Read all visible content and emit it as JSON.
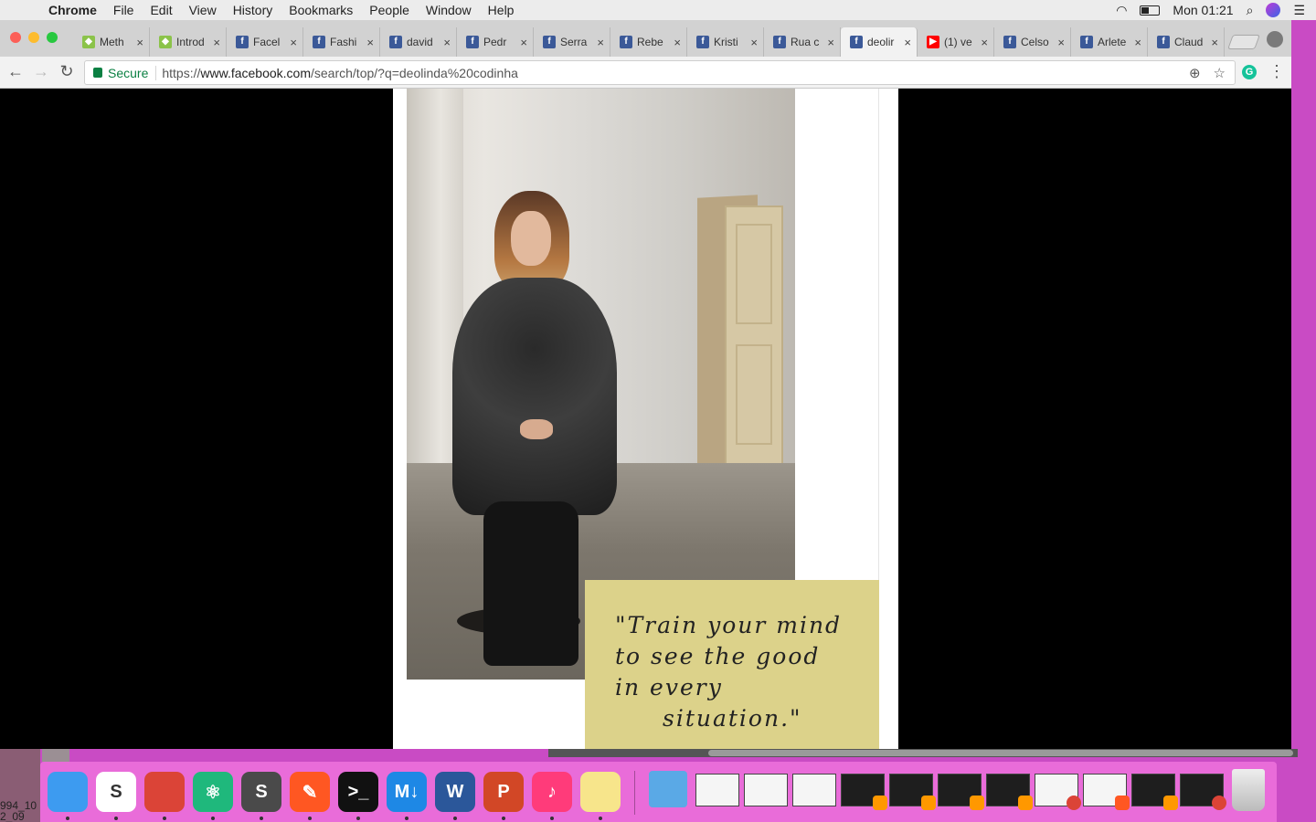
{
  "menubar": {
    "app_name": "Chrome",
    "items": [
      "File",
      "Edit",
      "View",
      "History",
      "Bookmarks",
      "People",
      "Window",
      "Help"
    ],
    "clock": "Mon 01:21"
  },
  "tabs": [
    {
      "label": "Meth",
      "icon": "angular-icon",
      "color": "#8bc34a"
    },
    {
      "label": "Introd",
      "icon": "angular-icon",
      "color": "#8bc34a"
    },
    {
      "label": "Facel",
      "icon": "facebook-icon",
      "color": "#3b5998"
    },
    {
      "label": "Fashi",
      "icon": "facebook-icon",
      "color": "#3b5998"
    },
    {
      "label": "david",
      "icon": "facebook-icon",
      "color": "#3b5998"
    },
    {
      "label": "Pedr",
      "icon": "facebook-icon",
      "color": "#3b5998"
    },
    {
      "label": "Serra",
      "icon": "facebook-icon",
      "color": "#3b5998"
    },
    {
      "label": "Rebe",
      "icon": "facebook-icon",
      "color": "#3b5998"
    },
    {
      "label": "Kristi",
      "icon": "facebook-icon",
      "color": "#3b5998"
    },
    {
      "label": "Rua c",
      "icon": "facebook-icon",
      "color": "#3b5998"
    },
    {
      "label": "deolir",
      "icon": "facebook-icon",
      "color": "#3b5998",
      "active": true
    },
    {
      "label": "(1) ve",
      "icon": "youtube-icon",
      "color": "#ff0000"
    },
    {
      "label": "Celso",
      "icon": "facebook-icon",
      "color": "#3b5998"
    },
    {
      "label": "Arlete",
      "icon": "facebook-icon",
      "color": "#3b5998"
    },
    {
      "label": "Claud",
      "icon": "facebook-icon",
      "color": "#3b5998"
    }
  ],
  "toolbar": {
    "secure_label": "Secure",
    "url_scheme": "https://",
    "url_host": "www.facebook.com",
    "url_path": "/search/top/?q=deolinda%20codinha"
  },
  "post": {
    "quote_lines": [
      "\"Train your mind",
      "to see the good",
      "in every",
      "situation.\""
    ],
    "quote_bg": "#dcd28a"
  },
  "desktop": {
    "thumb_label_1": "994_10",
    "thumb_label_2": "2_09"
  },
  "dock": {
    "apps": [
      {
        "name": "finder-icon",
        "glyph": "",
        "color": "#3d9bf0"
      },
      {
        "name": "slack-icon",
        "glyph": "S",
        "color": "#ffffff"
      },
      {
        "name": "chrome-icon",
        "glyph": "",
        "color": "#db4437"
      },
      {
        "name": "atom-icon",
        "glyph": "⚛",
        "color": "#1fb87c"
      },
      {
        "name": "sublime-text-icon",
        "glyph": "S",
        "color": "#4a4a4a"
      },
      {
        "name": "paw-icon",
        "glyph": "✎",
        "color": "#ff5722"
      },
      {
        "name": "terminal-icon",
        "glyph": ">_",
        "color": "#111111"
      },
      {
        "name": "markdown-editor-icon",
        "glyph": "M↓",
        "color": "#1e88e5"
      },
      {
        "name": "word-icon",
        "glyph": "W",
        "color": "#2b579a"
      },
      {
        "name": "powerpoint-icon",
        "glyph": "P",
        "color": "#d24726"
      },
      {
        "name": "itunes-icon",
        "glyph": "♪",
        "color": "#ff3b7a"
      },
      {
        "name": "notes-icon",
        "glyph": "",
        "color": "#f7e58b"
      }
    ]
  }
}
